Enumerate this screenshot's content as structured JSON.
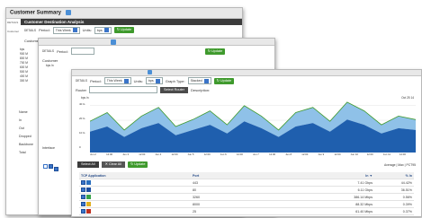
{
  "win1": {
    "title": "Customer Summary",
    "panel_title": "Customer Destination Analysis",
    "details_label": "DETAILS",
    "period_label": "Period:",
    "period_value": "This Week",
    "units_label": "Units:",
    "units_value": "bps",
    "update_label": "Update",
    "customer_label": "Customer",
    "select_customer": "Select Customer",
    "bps_label": "bps",
    "y_ticks": [
      "900 M",
      "800 M",
      "700 M",
      "600 M",
      "500 M",
      "400 M",
      "300 M",
      "200 M",
      "100 M"
    ],
    "side_rows": [
      "Name",
      "In",
      "Out",
      "Dropped",
      "Backbone",
      "Total"
    ]
  },
  "win2": {
    "details_label": "DETAILS",
    "period_label": "Period:",
    "update_label": "Update",
    "customer_label": "Customer",
    "bps_label": "bps In",
    "side_rows": [
      "Interface"
    ]
  },
  "win3": {
    "details_label": "DETAILS",
    "period_label": "Period:",
    "period_value": "This Week",
    "units_label": "Units:",
    "units_value": "bps",
    "graph_type_label": "Graph Type:",
    "graph_type_value": "Stacked",
    "update_label": "Update",
    "router_label": "Router",
    "select_router": "Select Router",
    "description_label": "Description:",
    "chart_left": "bps in",
    "chart_right": "Oct 25 14",
    "y_ticks": [
      "40 G",
      "20 G",
      "10 G",
      "0"
    ],
    "x_ticks": [
      "Jun 2",
      "12:00",
      "Jun 3",
      "12:00",
      "Jun 4",
      "12:00",
      "Jun 5",
      "12:00",
      "Jun 6",
      "12:00",
      "Jun 7",
      "12:00",
      "Jun 8",
      "12:00",
      "Jun 9",
      "12:00",
      "Jun 10",
      "12:00",
      "Jun 11",
      "12:00"
    ],
    "select_all": "Select All",
    "clear_all": "Clear All",
    "update2": "Update",
    "average_label": "Average | Max | PCT95",
    "table_head": [
      "TCP Application",
      "Port",
      "In ▼",
      "% In"
    ],
    "rows": [
      {
        "port": "443",
        "in": "7.41 Gbps",
        "pct": "44.42%",
        "color": "#2a6fbf"
      },
      {
        "port": "80",
        "in": "6.11 Gbps",
        "pct": "36.51%",
        "color": "#1d4ea0"
      },
      {
        "port": "3260",
        "in": "386.14 Mbps",
        "pct": "0.56%",
        "color": "#3aa34a"
      },
      {
        "port": "8000",
        "in": "88.32 Mbps",
        "pct": "0.39%",
        "color": "#e0b020"
      },
      {
        "port": "25",
        "in": "61.40 Mbps",
        "pct": "0.37%",
        "color": "#c03020"
      },
      {
        "port": "8001",
        "in": "60.28 Mbps",
        "pct": "0.36%",
        "color": "#8a5ab0"
      }
    ]
  },
  "chart_data": {
    "type": "area",
    "y_ticks": [
      "40 G",
      "20 G",
      "10 G",
      "0"
    ],
    "x_ticks": [
      "Jun 2",
      "Jun 3",
      "Jun 4",
      "Jun 5",
      "Jun 6",
      "Jun 7",
      "Jun 8",
      "Jun 9",
      "Jun 10",
      "Jun 11"
    ],
    "series": [
      {
        "values": [
          12,
          15,
          9,
          14,
          17,
          10,
          13,
          16,
          11,
          18,
          14,
          9,
          15,
          17,
          12,
          19,
          16,
          11,
          14,
          13
        ],
        "color": "#1f5fae"
      },
      {
        "values": [
          6,
          8,
          4,
          7,
          9,
          5,
          6,
          8,
          5,
          9,
          7,
          4,
          8,
          9,
          6,
          10,
          8,
          5,
          7,
          6
        ],
        "color": "#8fc1e8"
      }
    ]
  },
  "colors": {
    "accent": "#3a74c8",
    "green": "#3f9a2d",
    "dark": "#3b3b3b"
  }
}
